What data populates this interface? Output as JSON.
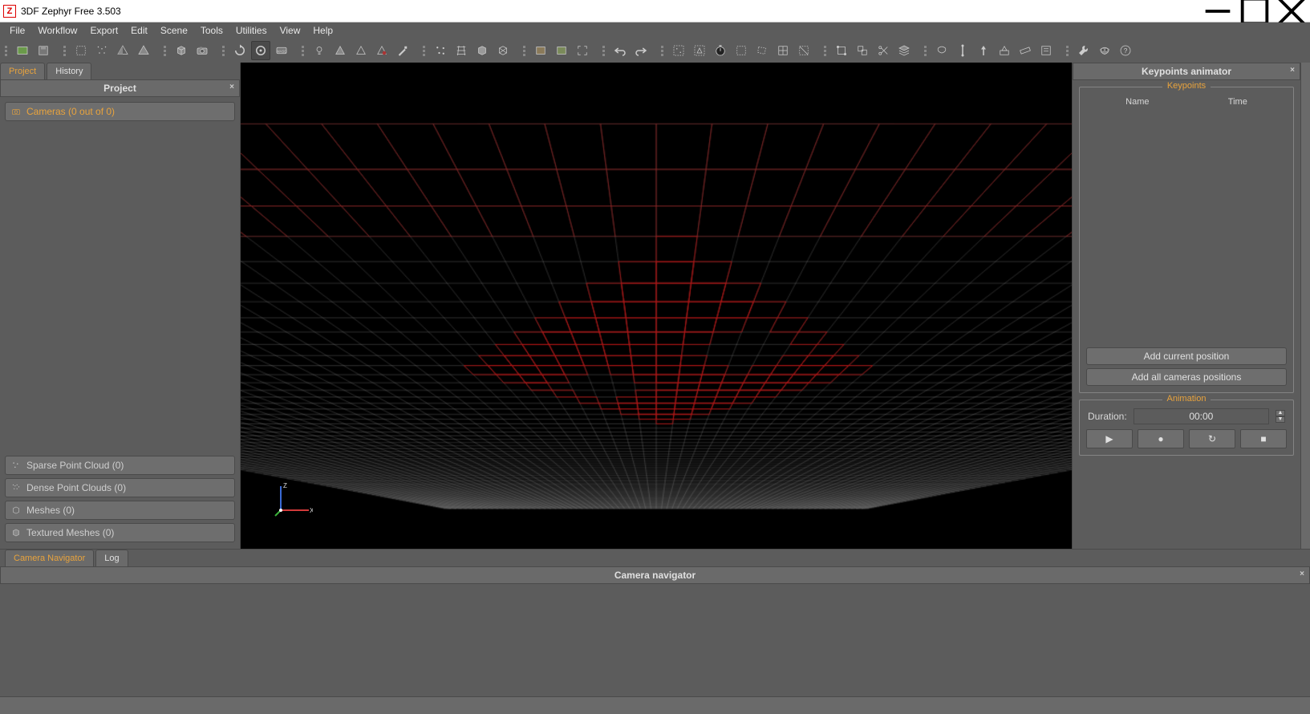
{
  "app": {
    "title": "3DF Zephyr Free 3.503",
    "icon_letter": "Z"
  },
  "menus": [
    "File",
    "Workflow",
    "Export",
    "Edit",
    "Scene",
    "Tools",
    "Utilities",
    "View",
    "Help"
  ],
  "toolbar_icons": [
    "new-project-icon",
    "save-icon",
    "bounding-box-icon",
    "sparse-cloud-icon",
    "mesh-icon",
    "mesh-wire-icon",
    "cube-icon",
    "camera-icon",
    "rotate-icon",
    "orbit-icon",
    "wasd-icon",
    "light-icon",
    "shade-flat-icon",
    "shade-smooth-icon",
    "shade-x-icon",
    "brush-icon",
    "points-tool-icon",
    "mesh-tool-icon",
    "solid-icon",
    "wire-solid-icon",
    "image-a-icon",
    "image-b-icon",
    "expand-icon",
    "undo-icon",
    "redo-icon",
    "select-points-icon",
    "select-mesh-icon",
    "stopwatch-icon",
    "select-rect-icon",
    "select-lasso-icon",
    "select-grid-icon",
    "select-crop-icon",
    "transform-icon",
    "align-icon",
    "scissors-icon",
    "layers-icon",
    "lasso-free-icon",
    "vertical-icon",
    "pin-down-icon",
    "extrude-icon",
    "ruler-icon",
    "note-icon",
    "wrench-icon",
    "mask-icon",
    "help-icon"
  ],
  "left": {
    "tabs": {
      "project": "Project",
      "history": "History",
      "active": "project"
    },
    "panel_title": "Project",
    "items": {
      "cameras": "Cameras (0 out of 0)",
      "sparse": "Sparse Point Cloud (0)",
      "dense": "Dense Point Clouds (0)",
      "meshes": "Meshes (0)",
      "textured": "Textured Meshes (0)"
    }
  },
  "viewport": {
    "axes": {
      "x": "X",
      "z": "Z"
    }
  },
  "right": {
    "title": "Keypoints animator",
    "keypoints": {
      "legend": "Keypoints",
      "col_name": "Name",
      "col_time": "Time",
      "add_current": "Add current position",
      "add_all": "Add all cameras positions"
    },
    "animation": {
      "legend": "Animation",
      "duration_label": "Duration:",
      "duration_value": "00:00",
      "buttons": {
        "play": "▶",
        "record": "●",
        "loop": "↻",
        "stop": "■"
      }
    }
  },
  "bottom": {
    "tabs": {
      "camera_nav": "Camera Navigator",
      "log": "Log",
      "active": "camera_nav"
    },
    "title": "Camera navigator"
  }
}
